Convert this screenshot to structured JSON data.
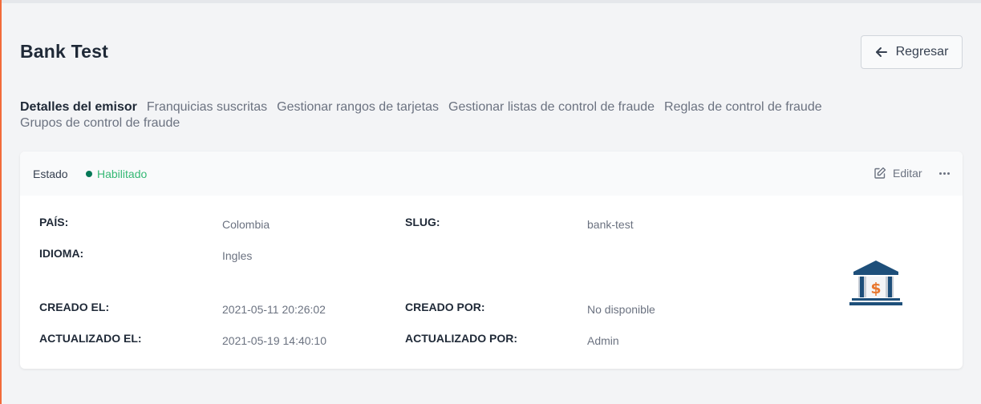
{
  "header": {
    "title": "Bank Test",
    "back_label": "Regresar"
  },
  "tabs": [
    {
      "label": "Detalles del emisor",
      "active": true
    },
    {
      "label": "Franquicias suscritas",
      "active": false
    },
    {
      "label": "Gestionar rangos de tarjetas",
      "active": false
    },
    {
      "label": "Gestionar listas de control de fraude",
      "active": false
    },
    {
      "label": "Reglas de control de fraude",
      "active": false
    },
    {
      "label": "Grupos de control de fraude",
      "active": false
    }
  ],
  "card": {
    "status_label": "Estado",
    "status_value": "Habilitado",
    "edit_label": "Editar",
    "fields": {
      "country_label": "PAÍS:",
      "country_value": "Colombia",
      "slug_label": "SLUG:",
      "slug_value": "bank-test",
      "language_label": "IDIOMA:",
      "language_value": "Ingles",
      "created_at_label": "CREADO EL:",
      "created_at_value": "2021-05-11 20:26:02",
      "created_by_label": "CREADO POR:",
      "created_by_value": "No disponible",
      "updated_at_label": "ACTUALIZADO EL:",
      "updated_at_value": "2021-05-19 14:40:10",
      "updated_by_label": "ACTUALIZADO POR:",
      "updated_by_value": "Admin"
    }
  },
  "icons": {
    "back": "arrow-left-icon",
    "edit": "edit-icon",
    "more": "more-horizontal-icon",
    "bank": "bank-icon"
  },
  "colors": {
    "accent_left_edge": "#f26b3a",
    "status_enabled": "#34b874",
    "status_dot": "#047857",
    "bank_icon_blue": "#1e4f7a",
    "bank_icon_orange": "#e8772e"
  }
}
